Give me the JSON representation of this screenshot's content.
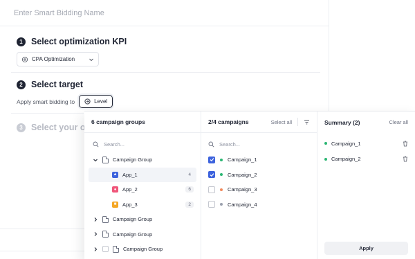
{
  "form": {
    "name_placeholder": "Enter Smart Bidding Name",
    "steps": [
      {
        "number": "1",
        "title": "Select optimization KPI"
      },
      {
        "number": "2",
        "title": "Select target"
      },
      {
        "number": "3",
        "title": "Select your opti"
      }
    ],
    "kpi_value": "CPA Optimization",
    "apply_label": "Apply smart bidding to",
    "level_label": "Level"
  },
  "groups": {
    "header": "6 campaign groups",
    "search_placeholder": "Search...",
    "rows": [
      {
        "label": "Campaign Group",
        "expanded": true
      },
      {
        "label": "App_1",
        "count": "4",
        "icon": "app-blue-icon",
        "color": "#3d63dd",
        "selected": true
      },
      {
        "label": "App_2",
        "count": "6",
        "icon": "app-pink-icon",
        "color": "#f0567a"
      },
      {
        "label": "App_3",
        "count": "2",
        "icon": "app-orange-icon",
        "color": "#f5a623"
      },
      {
        "label": "Campaign Group"
      },
      {
        "label": "Campaign Group"
      },
      {
        "label": "Campaign Group"
      }
    ]
  },
  "campaigns": {
    "header": "2/4 campaigns",
    "select_all": "Select all",
    "search_placeholder": "Search...",
    "rows": [
      {
        "label": "Campaign_1",
        "checked": true,
        "status_color": "#2bb673"
      },
      {
        "label": "Campaign_2",
        "checked": true,
        "status_color": "#2bb673"
      },
      {
        "label": "Campaign_3",
        "checked": false,
        "status_color": "#f08a5d"
      },
      {
        "label": "Campaign_4",
        "checked": false,
        "status_color": "#9aa0ad"
      }
    ]
  },
  "summary": {
    "header": "Summary (2)",
    "clear_all": "Clear all",
    "items": [
      {
        "label": "Campaign_1",
        "status_color": "#2bb673"
      },
      {
        "label": "Campaign_2",
        "status_color": "#2bb673"
      }
    ],
    "apply_label": "Apply"
  },
  "colors": {
    "accent": "#3d63dd",
    "active_green": "#2bb673",
    "text_dark": "#1f2433"
  }
}
